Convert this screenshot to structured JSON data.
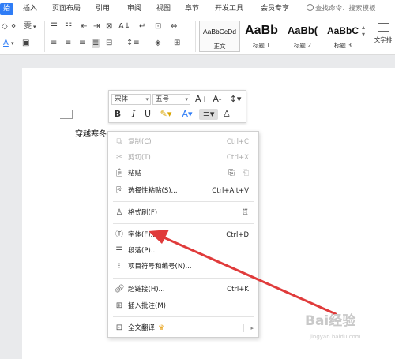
{
  "menubar": {
    "tabs": [
      "始",
      "插入",
      "页面布局",
      "引用",
      "审阅",
      "视图",
      "章节",
      "开发工具",
      "会员专享"
    ],
    "search_placeholder": "查找命令、搜索模板"
  },
  "ribbon": {
    "styles": [
      {
        "sample": "AaBbCcDd",
        "name": "正文"
      },
      {
        "sample": "AaBb",
        "name": "标题 1"
      },
      {
        "sample": "AaBb(",
        "name": "标题 2"
      },
      {
        "sample": "AaBbC",
        "name": "标题 3"
      }
    ],
    "wrap_label": "文字排",
    "colors": {
      "accent": "#2f7df6"
    }
  },
  "document": {
    "text": "穿越寒冬"
  },
  "mini_toolbar": {
    "font_name": "宋体",
    "font_size": "五号",
    "grow_label": "A+",
    "shrink_label": "A-",
    "bold": "B",
    "italic": "I",
    "underline": "U"
  },
  "context_menu": {
    "items": [
      {
        "icon": "copy-icon",
        "label": "复制(C)",
        "shortcut": "Ctrl+C",
        "disabled": true
      },
      {
        "icon": "cut-icon",
        "label": "剪切(T)",
        "shortcut": "Ctrl+X",
        "disabled": true
      },
      {
        "icon": "paste-icon",
        "label": "粘贴",
        "shortcut": "",
        "disabled": false
      },
      {
        "icon": "paste-special-icon",
        "label": "选择性粘贴(S)...",
        "shortcut": "Ctrl+Alt+V",
        "disabled": false
      },
      {
        "icon": "format-painter-icon",
        "label": "格式刷(F)",
        "shortcut": "",
        "disabled": false
      },
      {
        "icon": "font-icon",
        "label": "字体(F)...",
        "shortcut": "Ctrl+D",
        "disabled": false
      },
      {
        "icon": "paragraph-icon",
        "label": "段落(P)...",
        "shortcut": "",
        "disabled": false
      },
      {
        "icon": "list-icon",
        "label": "项目符号和编号(N)...",
        "shortcut": "",
        "disabled": false
      },
      {
        "icon": "hyperlink-icon",
        "label": "超链接(H)...",
        "shortcut": "Ctrl+K",
        "disabled": false
      },
      {
        "icon": "comment-icon",
        "label": "插入批注(M)",
        "shortcut": "",
        "disabled": false
      },
      {
        "icon": "translate-icon",
        "label": "全文翻译",
        "shortcut": "",
        "disabled": false
      }
    ]
  },
  "watermark": {
    "text": "Bai经验",
    "sub": "jingyan.baidu.com"
  }
}
